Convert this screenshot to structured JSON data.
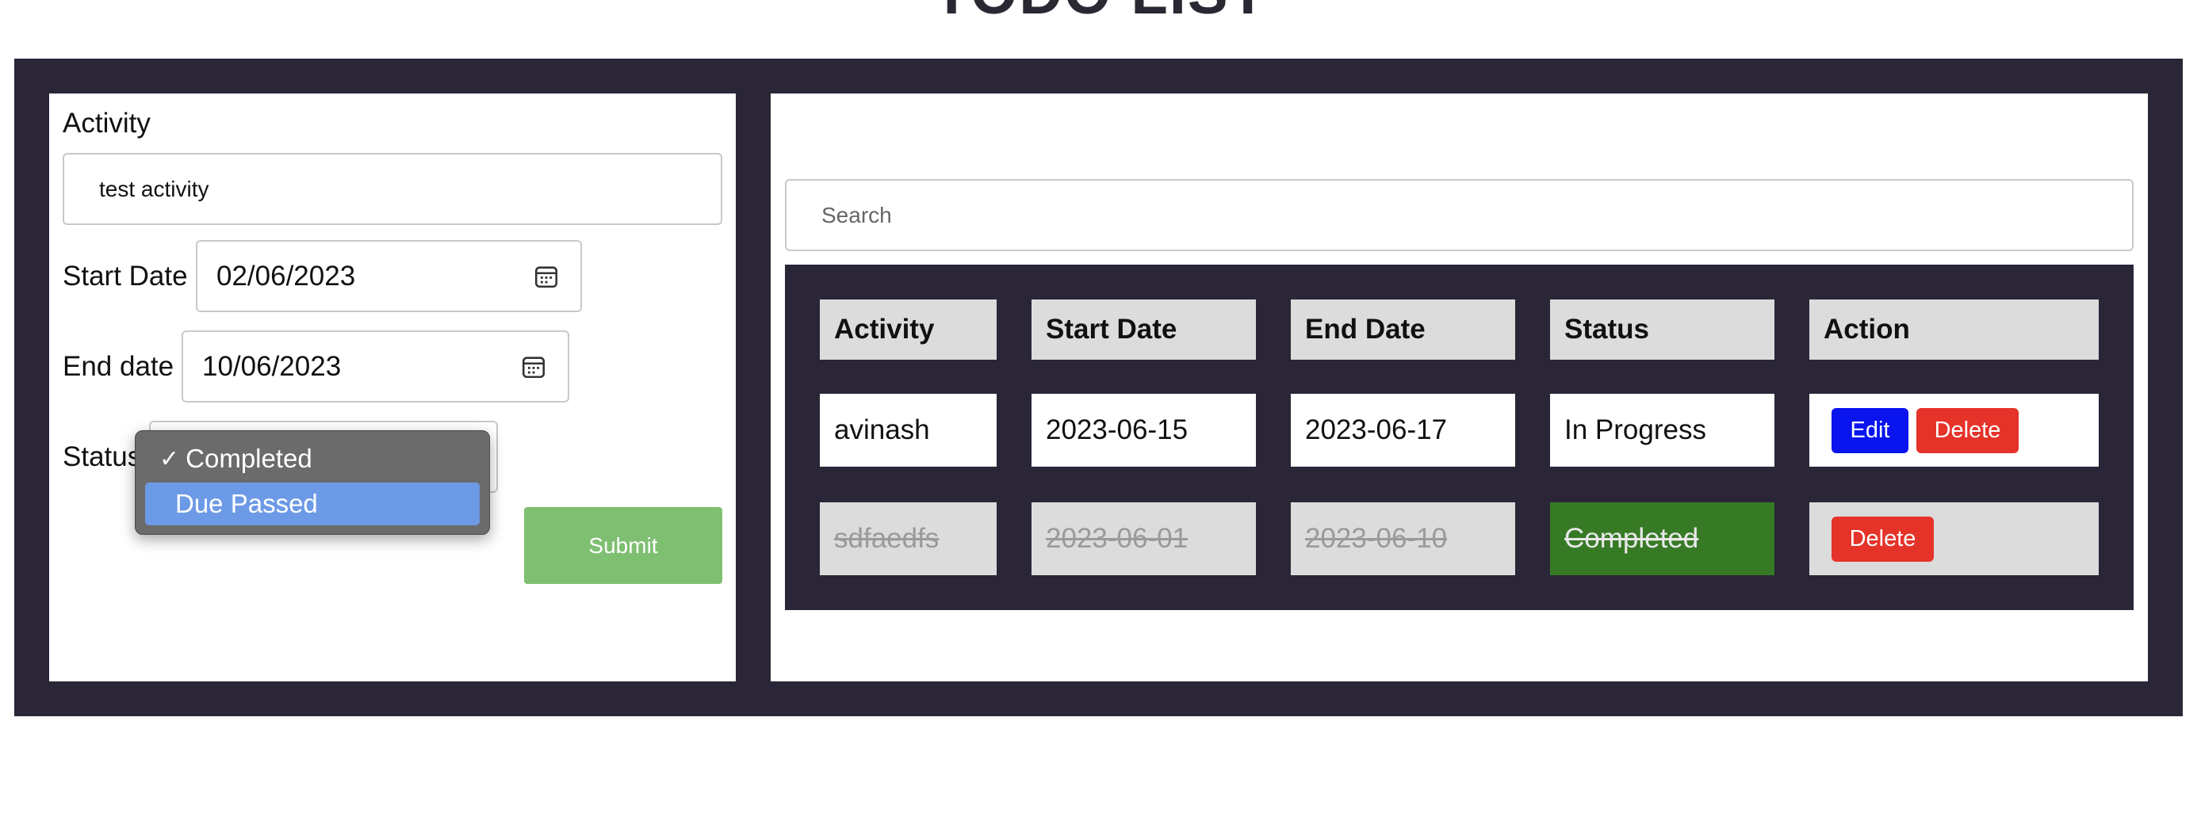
{
  "header": {
    "title": "TODO LIST"
  },
  "form": {
    "activity_label": "Activity",
    "activity_value": "test activity",
    "start_label": "Start Date",
    "start_value": "02/06/2023",
    "end_label": "End date",
    "end_value": "10/06/2023",
    "status_label": "Status",
    "status_options": [
      "Completed",
      "Due Passed"
    ],
    "status_check": "✓",
    "submit_label": "Submit"
  },
  "list": {
    "search_placeholder": "Search",
    "columns": [
      "Activity",
      "Start Date",
      "End Date",
      "Status",
      "Action"
    ],
    "rows": [
      {
        "activity": "avinash",
        "start": "2023-06-15",
        "end": "2023-06-17",
        "status": "In Progress",
        "actions": [
          "Edit",
          "Delete"
        ]
      },
      {
        "activity": "sdfaedfs",
        "start": "2023-06-01",
        "end": "2023-06-10",
        "status": "Completed",
        "actions": [
          "Delete"
        ]
      }
    ]
  },
  "colors": {
    "frame": "#2a2637",
    "submit": "#7fbf72",
    "edit": "#0a14ee",
    "delete": "#e5332a",
    "completed": "#377a25",
    "dropdown_highlight": "#6d9ae6"
  },
  "icons": {
    "date_picker": "calendar-icon",
    "select": "chevron-down-icon"
  }
}
